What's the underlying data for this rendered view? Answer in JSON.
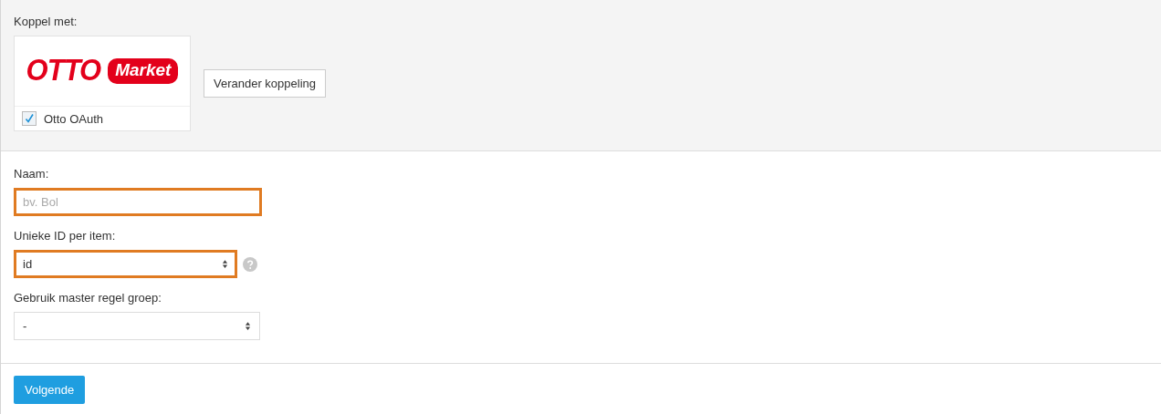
{
  "connection": {
    "label": "Koppel met:",
    "logo": {
      "brand": "OTTO",
      "product": "Market"
    },
    "checkbox": {
      "label": "Otto OAuth",
      "checked": true
    },
    "change_button": "Verander koppeling"
  },
  "fields": [
    {
      "kind": "text",
      "label": "Naam:",
      "placeholder": "bv. Bol",
      "highlighted": true,
      "help": false
    },
    {
      "kind": "select",
      "label": "Unieke ID per item:",
      "value": "id",
      "highlighted": true,
      "help": true
    },
    {
      "kind": "select",
      "label": "Gebruik master regel groep:",
      "value": "-",
      "highlighted": false,
      "help": false
    }
  ],
  "next_button": "Volgende"
}
